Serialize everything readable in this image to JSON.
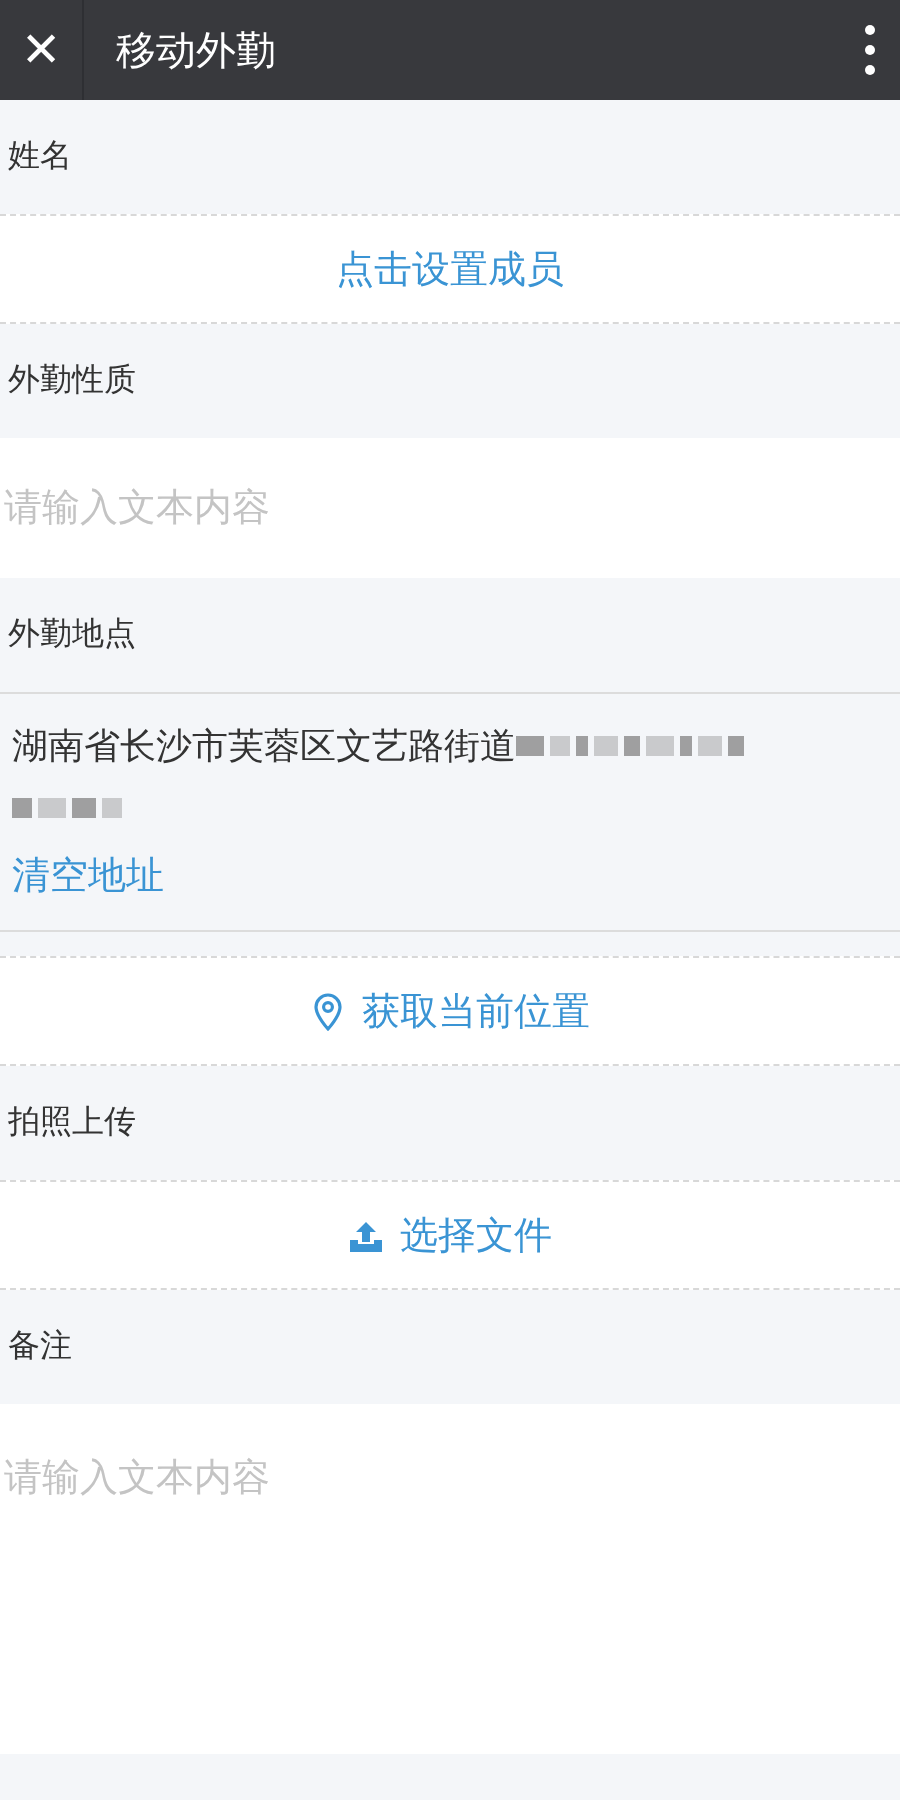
{
  "header": {
    "close": "✕",
    "title": "移动外勤"
  },
  "sections": [
    {
      "kind": "label",
      "text": "姓名"
    },
    {
      "kind": "action",
      "text": "点击设置成员"
    },
    {
      "kind": "label",
      "text": "外勤性质"
    },
    {
      "kind": "input",
      "placeholder": "请输入文本内容"
    },
    {
      "kind": "label",
      "text": "外勤地点"
    },
    {
      "kind": "address",
      "text": "湖南省长沙市芙蓉区文艺路街道",
      "link": "清空地址"
    },
    {
      "kind": "locate",
      "text": "获取当前位置"
    },
    {
      "kind": "label",
      "text": "拍照上传"
    },
    {
      "kind": "upload",
      "text": "选择文件"
    },
    {
      "kind": "label",
      "text": "备注"
    },
    {
      "kind": "textarea",
      "placeholder": "请输入文本内容"
    }
  ]
}
